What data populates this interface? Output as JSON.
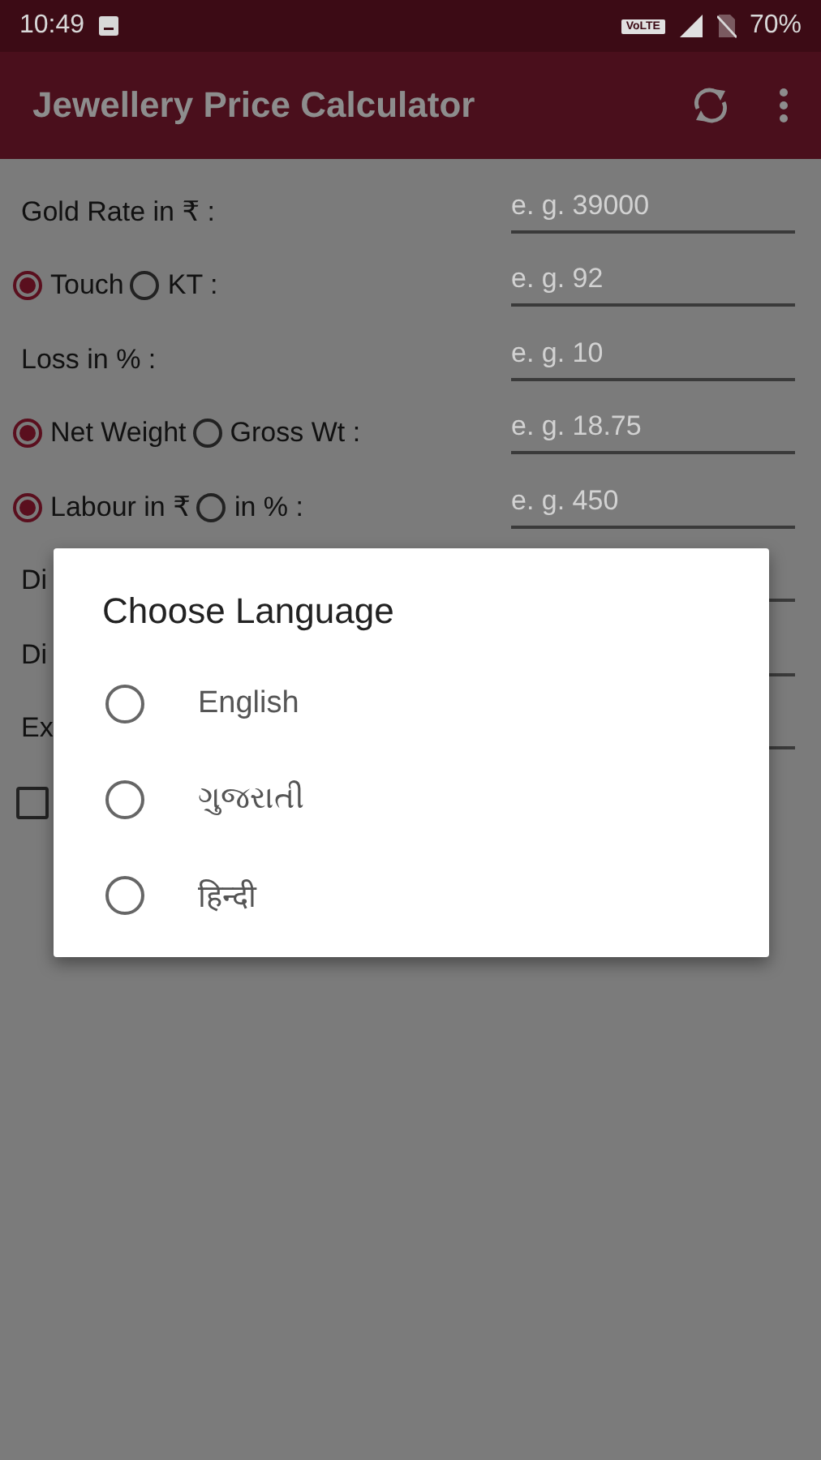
{
  "status_bar": {
    "time": "10:49",
    "volte": "VoLTE",
    "battery": "70%"
  },
  "app_bar": {
    "title": "Jewellery Price Calculator"
  },
  "form": {
    "rows": [
      {
        "kind": "field",
        "label": "Gold Rate in ₹ :",
        "placeholder": "e. g. 39000"
      },
      {
        "kind": "radio_field",
        "options": [
          {
            "label": "Touch",
            "selected": true
          },
          {
            "label": "KT :",
            "selected": false
          }
        ],
        "placeholder": "e. g. 92"
      },
      {
        "kind": "field",
        "label": "Loss in % :",
        "placeholder": "e. g. 10"
      },
      {
        "kind": "radio_field",
        "options": [
          {
            "label": "Net Weight",
            "selected": true
          },
          {
            "label": "Gross Wt :",
            "selected": false
          }
        ],
        "placeholder": "e. g. 18.75"
      },
      {
        "kind": "radio_field",
        "options": [
          {
            "label": "Labour in ₹",
            "selected": true
          },
          {
            "label": "in % :",
            "selected": false
          }
        ],
        "placeholder": "e. g. 450"
      },
      {
        "kind": "field",
        "label": "Di"
      },
      {
        "kind": "field",
        "label": "Di"
      },
      {
        "kind": "field",
        "label": "Ex"
      },
      {
        "kind": "checkbox",
        "checked": false
      }
    ]
  },
  "dialog": {
    "title": "Choose Language",
    "options": [
      {
        "label": "English",
        "selected": false
      },
      {
        "label": "ગુજરાતી",
        "selected": false
      },
      {
        "label": "हिन्दी",
        "selected": false
      }
    ]
  }
}
